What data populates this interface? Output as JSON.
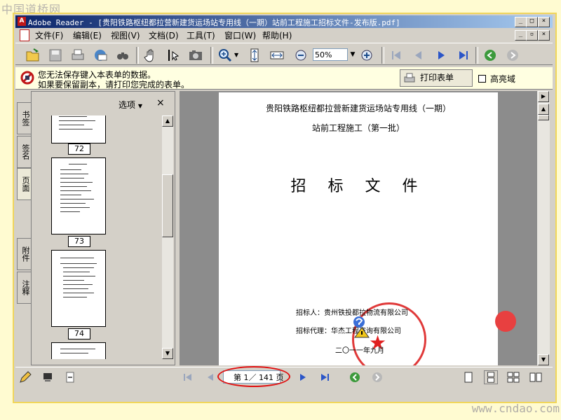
{
  "watermarks": {
    "top": "中国道桥网",
    "bottom": "www.cndao.com"
  },
  "window": {
    "title": "Adobe Reader - [贵阳铁路枢纽都拉营新建货运场站专用线（一期）站前工程施工招标文件-发布版.pdf]"
  },
  "menu": {
    "items": [
      "文件(F)",
      "编辑(E)",
      "视图(V)",
      "文档(D)",
      "工具(T)",
      "窗口(W)",
      "帮助(H)"
    ]
  },
  "toolbar": {
    "zoom_value": "50%"
  },
  "notification": {
    "line1": "您无法保存键入本表单的数据。",
    "line2": "如果要保留副本，请打印您完成的表单。",
    "print_form_label": "打印表单",
    "highlight_label": "高亮域"
  },
  "side_tabs": [
    "书签",
    "签名",
    "页面",
    "附件",
    "注释"
  ],
  "nav_pane": {
    "options_label": "选项",
    "close_label": "×",
    "thumbnails": [
      "72",
      "73",
      "74"
    ]
  },
  "document": {
    "heading1": "贵阳铁路枢纽都拉营新建货运场站专用线（一期）",
    "heading2": "站前工程施工（第一批）",
    "main_title": "招 标 文 件",
    "tenderer": "招标人：贵州铁投都拉物流有限公司",
    "agent": "招标代理：华杰工程咨询有限公司",
    "date": "二〇一一年九月"
  },
  "status": {
    "page_indicator": "第 1／ 141 页"
  }
}
